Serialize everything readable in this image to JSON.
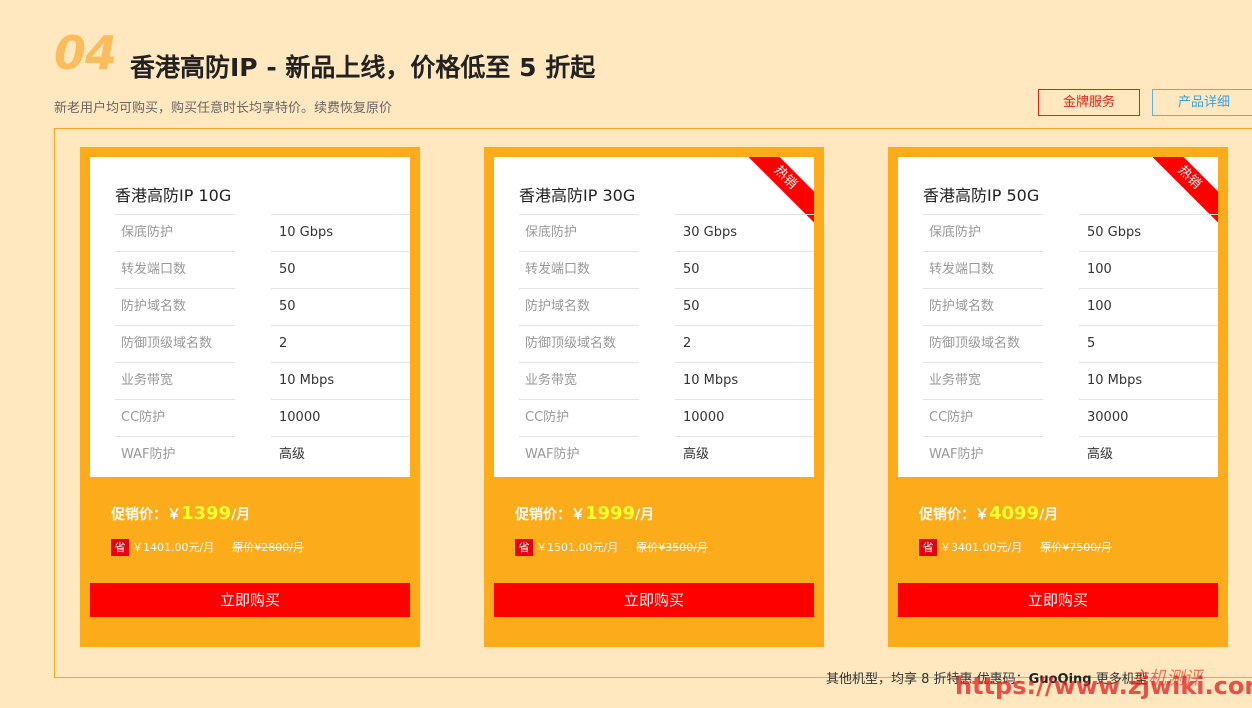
{
  "header": {
    "number": "04",
    "title": "香港高防IP - 新品上线，价格低至 5 折起",
    "subtitle": "新老用户均可购买，购买任意时长均享特价。续费恢复原价",
    "gold_service": "金牌服务",
    "product_detail": "产品详细"
  },
  "cards": [
    {
      "title": "香港高防IP 10G",
      "hot": "",
      "rows": [
        {
          "k": "保底防护",
          "v": "10 Gbps"
        },
        {
          "k": "转发端口数",
          "v": "50"
        },
        {
          "k": "防护域名数",
          "v": "50"
        },
        {
          "k": "防御顶级域名数",
          "v": "2"
        },
        {
          "k": "业务带宽",
          "v": "10 Mbps"
        },
        {
          "k": "CC防护",
          "v": "10000"
        },
        {
          "k": "WAF防护",
          "v": "高级"
        }
      ],
      "price_label": "促销价：￥",
      "price": "1399",
      "per": "/月",
      "save_tag": "省",
      "save": "￥1401.00元/月",
      "original": "原价¥2800/月",
      "buy": "立即购买"
    },
    {
      "title": "香港高防IP 30G",
      "hot": "热销",
      "rows": [
        {
          "k": "保底防护",
          "v": "30 Gbps"
        },
        {
          "k": "转发端口数",
          "v": "50"
        },
        {
          "k": "防护域名数",
          "v": "50"
        },
        {
          "k": "防御顶级域名数",
          "v": "2"
        },
        {
          "k": "业务带宽",
          "v": "10 Mbps"
        },
        {
          "k": "CC防护",
          "v": "10000"
        },
        {
          "k": "WAF防护",
          "v": "高级"
        }
      ],
      "price_label": "促销价：￥",
      "price": "1999",
      "per": "/月",
      "save_tag": "省",
      "save": "￥1501.00元/月",
      "original": "原价¥3500/月",
      "buy": "立即购买"
    },
    {
      "title": "香港高防IP 50G",
      "hot": "热销",
      "rows": [
        {
          "k": "保底防护",
          "v": "50 Gbps"
        },
        {
          "k": "转发端口数",
          "v": "100"
        },
        {
          "k": "防护域名数",
          "v": "100"
        },
        {
          "k": "防御顶级域名数",
          "v": "5"
        },
        {
          "k": "业务带宽",
          "v": "10 Mbps"
        },
        {
          "k": "CC防护",
          "v": "30000"
        },
        {
          "k": "WAF防护",
          "v": "高级"
        }
      ],
      "price_label": "促销价：￥",
      "price": "4099",
      "per": "/月",
      "save_tag": "省",
      "save": "￥3401.00元/月",
      "original": "原价¥7500/月",
      "buy": "立即购买"
    }
  ],
  "footer": {
    "text": "其他机型，均享 8 折特惠 优惠码：",
    "code": "GuoQing",
    "more": "更多机型"
  },
  "watermark": {
    "url": "https://www.zjwiki.com",
    "cn": "主机测评"
  },
  "colors": {
    "background": "#ffe7c0",
    "card": "#fcab1a",
    "buy": "#ff0000",
    "price": "#ffff33"
  }
}
